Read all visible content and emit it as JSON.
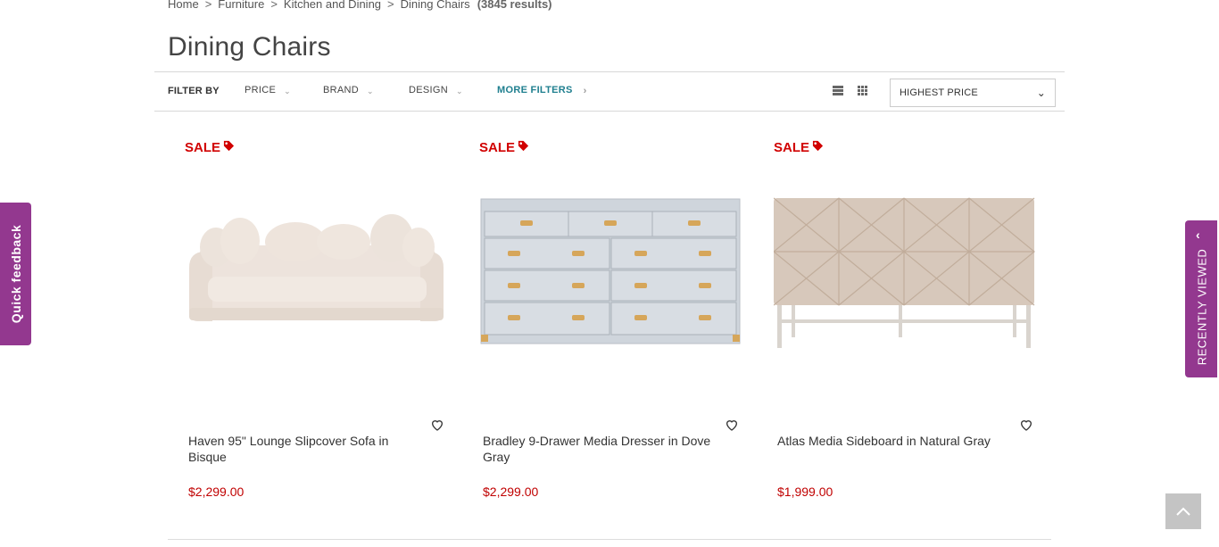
{
  "breadcrumb": {
    "items": [
      "Home",
      "Furniture",
      "Kitchen and Dining",
      "Dining Chairs"
    ],
    "separator": ">",
    "count": "(3845 results)"
  },
  "page": {
    "title": "Dining Chairs"
  },
  "filters": {
    "label": "FILTER BY",
    "items": [
      "PRICE",
      "BRAND",
      "DESIGN"
    ],
    "more": "MORE FILTERS"
  },
  "sort": {
    "selected": "HIGHEST PRICE"
  },
  "products": [
    {
      "badge": "SALE",
      "name": "Haven 95\" Lounge Slipcover Sofa in Bisque",
      "price": "$2,299.00"
    },
    {
      "badge": "SALE",
      "name": "Bradley 9-Drawer Media Dresser in Dove Gray",
      "price": "$2,299.00"
    },
    {
      "badge": "SALE",
      "name": "Atlas Media Sideboard in Natural Gray",
      "price": "$1,999.00"
    }
  ],
  "side_tabs": {
    "quick_feedback": "Quick feedback",
    "recently_viewed": "RECENTLY VIEWED"
  },
  "colors": {
    "accent_purple": "#93388f",
    "sale_red": "#d10000",
    "price_red": "#c00000",
    "link_teal": "#1f7f8f"
  }
}
